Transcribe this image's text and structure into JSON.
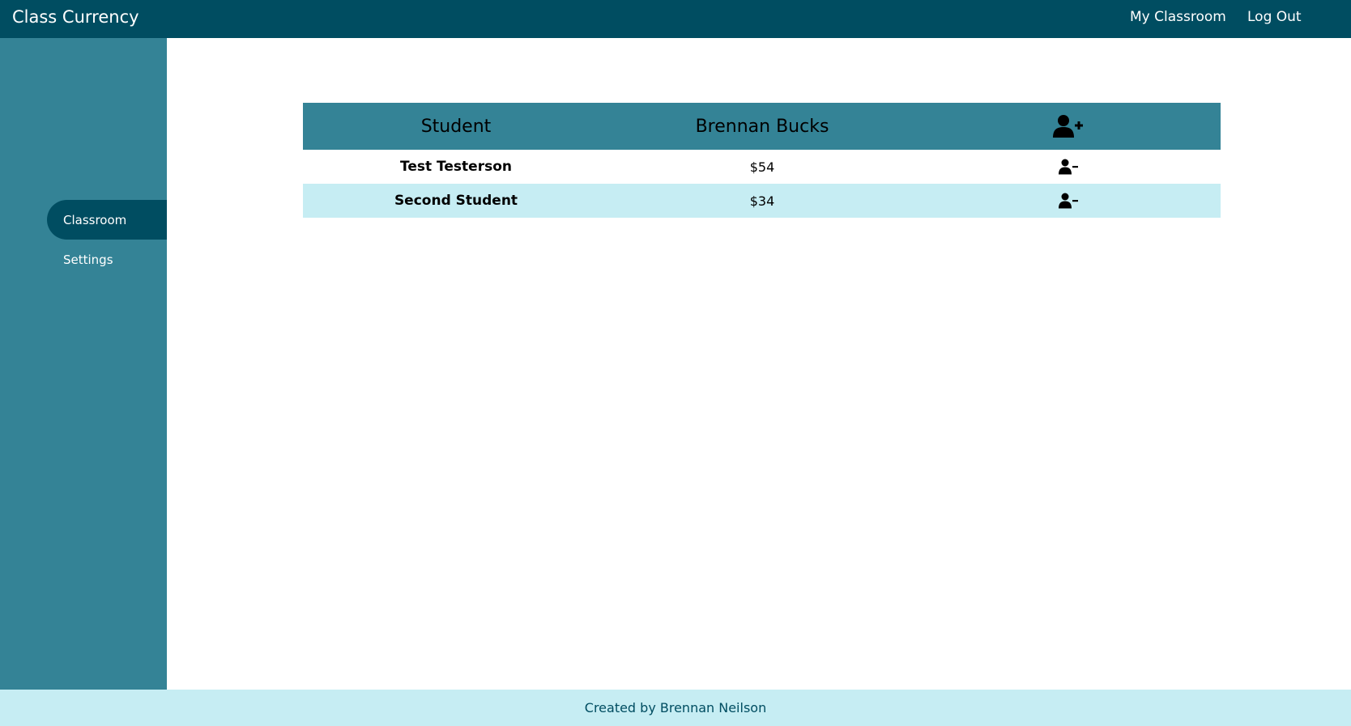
{
  "header": {
    "brand": "Class Currency",
    "nav": {
      "my_classroom": "My Classroom",
      "log_out": "Log Out"
    }
  },
  "sidebar": {
    "items": [
      {
        "label": "Classroom",
        "active": true
      },
      {
        "label": "Settings",
        "active": false
      }
    ]
  },
  "table": {
    "columns": [
      "Student",
      "Brennan Bucks"
    ],
    "add_icon": "user-plus-icon",
    "remove_icon": "user-minus-icon",
    "rows": [
      {
        "student": "Test Testerson",
        "bucks": "$54"
      },
      {
        "student": "Second Student",
        "bucks": "$34"
      }
    ]
  },
  "footer": {
    "text": "Created by Brennan Neilson"
  },
  "colors": {
    "header_bg": "#004d61",
    "sidebar_bg": "#348396",
    "table_header_bg": "#348396",
    "alt_row_bg": "#c6edf3",
    "footer_bg": "#c6edf3"
  }
}
